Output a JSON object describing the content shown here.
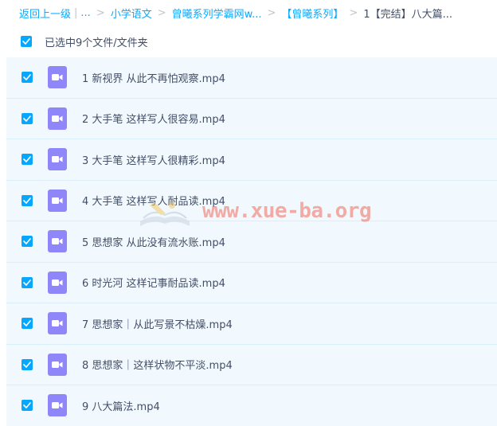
{
  "breadcrumb": {
    "back": "返回上一级",
    "sep1": "|",
    "ellipsis": "...",
    "items": [
      "小学语文",
      "曾曦系列学霸网w...",
      "【曾曦系列】"
    ],
    "current": "1【完结】八大篇..."
  },
  "selection": {
    "label": "已选中9个文件/文件夹",
    "checked": true
  },
  "files": [
    {
      "name": "1 新视界 从此不再怕观察.mp4",
      "checked": true
    },
    {
      "name": "2 大手笔 这样写人很容易.mp4",
      "checked": true
    },
    {
      "name": "3 大手笔 这样写人很精彩.mp4",
      "checked": true
    },
    {
      "name": "4 大手笔 这样写人耐品读.mp4",
      "checked": true
    },
    {
      "name": "5 思想家 从此没有流水账.mp4",
      "checked": true
    },
    {
      "name": "6 时光河 这样记事耐品读.mp4",
      "checked": true
    },
    {
      "name": "7 思想家｜从此写景不枯燥.mp4",
      "checked": true
    },
    {
      "name": "8 思想家｜这样状物不平淡.mp4",
      "checked": true
    },
    {
      "name": "9 八大篇法.mp4",
      "checked": true
    }
  ],
  "watermark": {
    "text": "www.xue-ba.org"
  },
  "colors": {
    "accent": "#06a7ff",
    "link": "#09aaff",
    "row_selected_bg": "#f1f9fe",
    "video_icon": "#8f86f9",
    "text": "#424e67"
  },
  "icons": {
    "checkbox": "checkmark-icon",
    "file": "video-file-icon"
  }
}
